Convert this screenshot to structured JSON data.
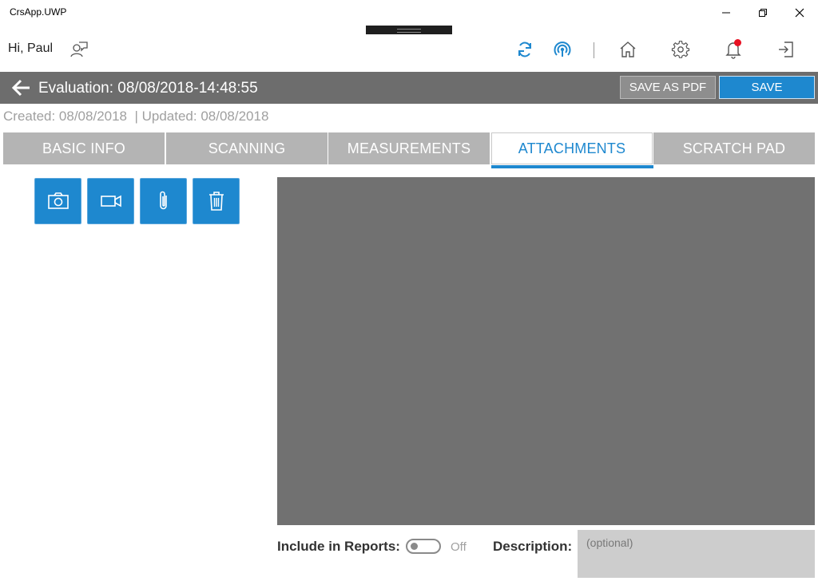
{
  "window": {
    "title": "CrsApp.UWP"
  },
  "header": {
    "greeting": "Hi, Paul"
  },
  "evaluation": {
    "title": "Evaluation: 08/08/2018-14:48:55",
    "save_as_pdf_label": "SAVE AS PDF",
    "save_label": "SAVE",
    "dates": "Created: 08/08/2018  | Updated: 08/08/2018"
  },
  "tabs": [
    {
      "label": "BASIC INFO",
      "active": false
    },
    {
      "label": "SCANNING",
      "active": false
    },
    {
      "label": "MEASUREMENTS",
      "active": false
    },
    {
      "label": "ATTACHMENTS",
      "active": true
    },
    {
      "label": "SCRATCH PAD",
      "active": false
    }
  ],
  "attachments": {
    "actions": [
      "camera-icon",
      "video-camera-icon",
      "paperclip-icon",
      "trash-icon"
    ],
    "include_label": "Include in Reports:",
    "include_state": "Off",
    "include_on": false,
    "description_label": "Description:",
    "description_placeholder": "(optional)",
    "description_value": ""
  },
  "colors": {
    "accent": "#1e88cf",
    "bar_gray": "#6d6d6d",
    "tab_gray": "#b4b4b4",
    "preview_gray": "#717171",
    "notification_dot": "#e81123"
  }
}
